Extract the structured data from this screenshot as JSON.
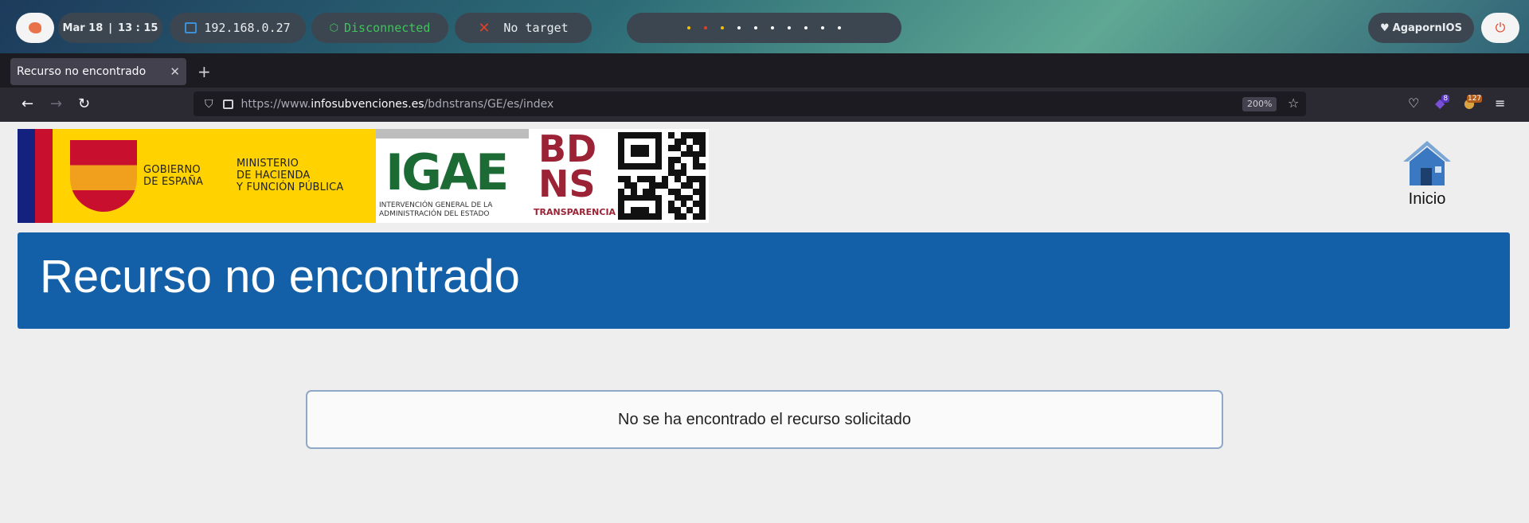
{
  "topbar": {
    "date": "Mar 18",
    "time": "13 : 15",
    "ip": "192.168.0.27",
    "vpn_status": "Disconnected",
    "target": "No target",
    "user": "AgapornIOS",
    "workspace_dot_colors": [
      "#f5c000",
      "#e0402a",
      "#f5c000",
      "#ffffff",
      "#ffffff",
      "#ffffff",
      "#ffffff",
      "#ffffff",
      "#ffffff",
      "#ffffff"
    ]
  },
  "browser": {
    "tab_title": "Recurso no encontrado",
    "url_prefix": "https://www.",
    "url_domain": "infosubvenciones.es",
    "url_path": "/bdnstrans/GE/es/index",
    "zoom": "200%",
    "ext_badge_1": "8",
    "ext_badge_2": "127"
  },
  "page": {
    "logo_gob_1": "GOBIERNO\nDE ESPAÑA",
    "logo_gob_2": "MINISTERIO\nDE HACIENDA\nY FUNCIÓN PÚBLICA",
    "logo_igae": "IGAE",
    "logo_igae_sub": "INTERVENCIÓN GENERAL DE LA\nADMINISTRACIÓN DEL ESTADO",
    "logo_bdns_1": "BD",
    "logo_bdns_2": "NS",
    "logo_bdns_3": "TRANSPARENCIA",
    "home_label": "Inicio",
    "heading": "Recurso no encontrado",
    "message": "No se ha encontrado el recurso solicitado"
  }
}
